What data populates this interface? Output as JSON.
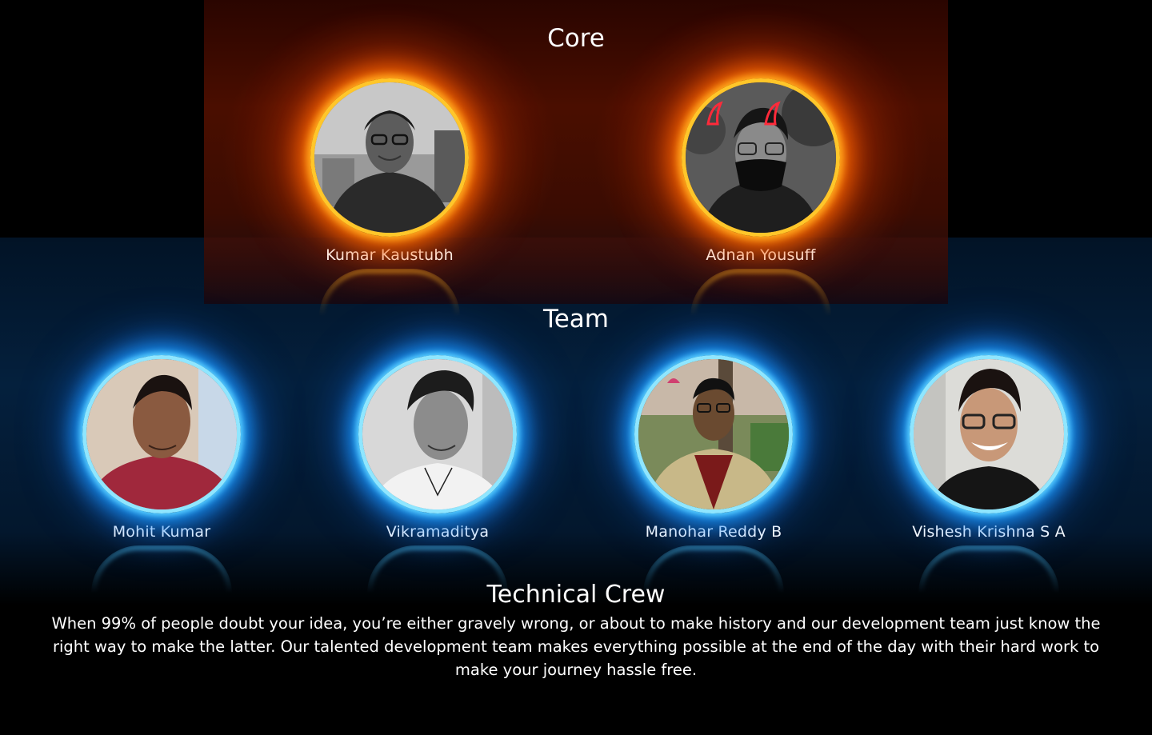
{
  "sections": {
    "core": {
      "title": "Core",
      "members": [
        {
          "name": "Kumar Kaustubh"
        },
        {
          "name": "Adnan Yousuff"
        }
      ]
    },
    "team": {
      "title": "Team",
      "members": [
        {
          "name": "Mohit Kumar"
        },
        {
          "name": "Vikramaditya"
        },
        {
          "name": "Manohar Reddy B"
        },
        {
          "name": "Vishesh Krishna S A"
        }
      ]
    },
    "crew": {
      "title": "Technical Crew",
      "description": "When 99% of people doubt your idea, you’re either gravely wrong, or about to make history and our development team just know the right way to make the latter. Our talented development team makes everything possible at the end of the day with their hard work to make your journey hassle free."
    }
  },
  "colors": {
    "core_ring": "#ffc62a",
    "core_glow": "#ff6a00",
    "team_ring": "#8fe6ff",
    "team_glow": "#1a9aff",
    "background": "#000000"
  }
}
